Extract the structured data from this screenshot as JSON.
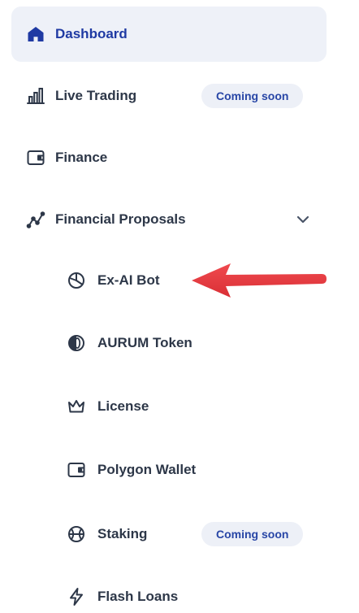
{
  "nav": {
    "items": [
      {
        "label": "Dashboard",
        "icon": "home-icon",
        "active": true
      },
      {
        "label": "Live Trading",
        "icon": "bar-chart-icon",
        "badge": "Coming soon"
      },
      {
        "label": "Finance",
        "icon": "wallet-icon"
      },
      {
        "label": "Financial Proposals",
        "icon": "trend-icon",
        "expanded": true
      }
    ],
    "subitems": [
      {
        "label": "Ex-AI Bot",
        "icon": "pie-chart-icon"
      },
      {
        "label": "AURUM Token",
        "icon": "coin-icon"
      },
      {
        "label": "License",
        "icon": "crown-icon"
      },
      {
        "label": "Polygon Wallet",
        "icon": "wallet-icon"
      },
      {
        "label": "Staking",
        "icon": "basketball-icon",
        "badge": "Coming soon"
      },
      {
        "label": "Flash Loans",
        "icon": "lightning-icon"
      }
    ]
  },
  "colors": {
    "active_text": "#1f3aa3",
    "active_bg": "#eef1f8",
    "text": "#2d3748",
    "badge_bg": "#edf0f7",
    "badge_text": "#2846a6",
    "arrow": "#e5373d"
  }
}
